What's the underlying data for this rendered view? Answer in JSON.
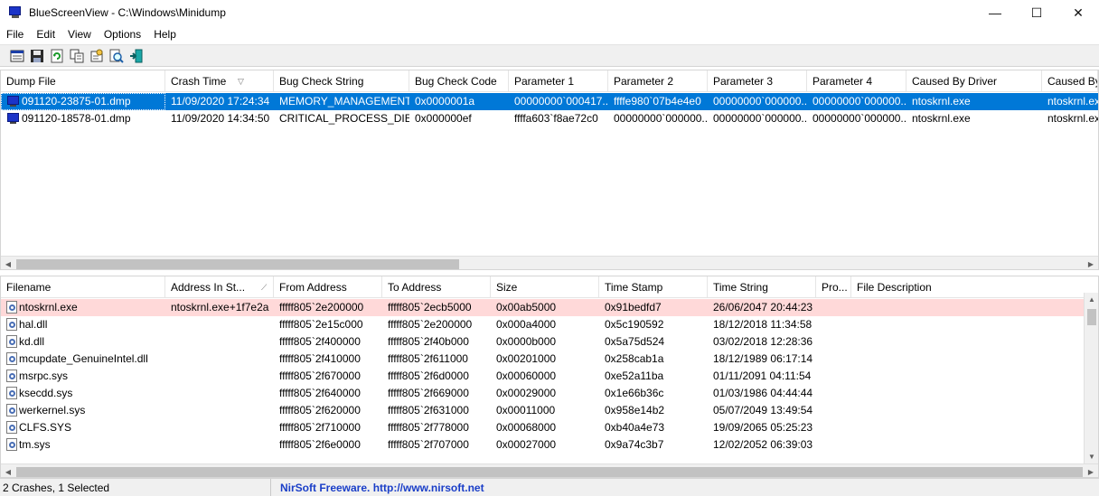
{
  "window": {
    "app_name": "BlueScreenView",
    "separator": " - ",
    "path": "C:\\Windows\\Minidump",
    "min": "—",
    "max": "☐",
    "close": "✕"
  },
  "menu": [
    "File",
    "Edit",
    "View",
    "Options",
    "Help"
  ],
  "upper": {
    "columns": [
      "Dump File",
      "Crash Time",
      "Bug Check String",
      "Bug Check Code",
      "Parameter 1",
      "Parameter 2",
      "Parameter 3",
      "Parameter 4",
      "Caused By Driver",
      "Caused By"
    ],
    "rows": [
      [
        "091120-23875-01.dmp",
        "11/09/2020 17:24:34",
        "MEMORY_MANAGEMENT",
        "0x0000001a",
        "00000000`000417...",
        "ffffe980`07b4e4e0",
        "00000000`000000...",
        "00000000`000000...",
        "ntoskrnl.exe",
        "ntoskrnl.exe"
      ],
      [
        "091120-18578-01.dmp",
        "11/09/2020 14:34:50",
        "CRITICAL_PROCESS_DIED",
        "0x000000ef",
        "ffffa603`f8ae72c0",
        "00000000`000000...",
        "00000000`000000...",
        "00000000`000000...",
        "ntoskrnl.exe",
        "ntoskrnl.exe"
      ]
    ]
  },
  "lower": {
    "columns": [
      "Filename",
      "Address In St...",
      "From Address",
      "To Address",
      "Size",
      "Time Stamp",
      "Time String",
      "Pro...",
      "File Description"
    ],
    "rows": [
      [
        "ntoskrnl.exe",
        "ntoskrnl.exe+1f7e2a",
        "fffff805`2e200000",
        "fffff805`2ecb5000",
        "0x00ab5000",
        "0x91bedfd7",
        "26/06/2047 20:44:23",
        "",
        ""
      ],
      [
        "hal.dll",
        "",
        "fffff805`2e15c000",
        "fffff805`2e200000",
        "0x000a4000",
        "0x5c190592",
        "18/12/2018 11:34:58",
        "",
        ""
      ],
      [
        "kd.dll",
        "",
        "fffff805`2f400000",
        "fffff805`2f40b000",
        "0x0000b000",
        "0x5a75d524",
        "03/02/2018 12:28:36",
        "",
        ""
      ],
      [
        "mcupdate_GenuineIntel.dll",
        "",
        "fffff805`2f410000",
        "fffff805`2f611000",
        "0x00201000",
        "0x258cab1a",
        "18/12/1989 06:17:14",
        "",
        ""
      ],
      [
        "msrpc.sys",
        "",
        "fffff805`2f670000",
        "fffff805`2f6d0000",
        "0x00060000",
        "0xe52a11ba",
        "01/11/2091 04:11:54",
        "",
        ""
      ],
      [
        "ksecdd.sys",
        "",
        "fffff805`2f640000",
        "fffff805`2f669000",
        "0x00029000",
        "0x1e66b36c",
        "01/03/1986 04:44:44",
        "",
        ""
      ],
      [
        "werkernel.sys",
        "",
        "fffff805`2f620000",
        "fffff805`2f631000",
        "0x00011000",
        "0x958e14b2",
        "05/07/2049 13:49:54",
        "",
        ""
      ],
      [
        "CLFS.SYS",
        "",
        "fffff805`2f710000",
        "fffff805`2f778000",
        "0x00068000",
        "0xb40a4e73",
        "19/09/2065 05:25:23",
        "",
        ""
      ],
      [
        "tm.sys",
        "",
        "fffff805`2f6e0000",
        "fffff805`2f707000",
        "0x00027000",
        "0x9a74c3b7",
        "12/02/2052 06:39:03",
        "",
        ""
      ]
    ]
  },
  "status": {
    "count": "2 Crashes, 1 Selected",
    "link": "NirSoft Freeware.  http://www.nirsoft.net"
  },
  "colors": {
    "selection": "#0078d7",
    "highlight_row": "#ffd9d9",
    "link": "#1a3ec8"
  },
  "icons": {
    "app": "bluescreen-monitor-icon",
    "dump": "bluescreen-monitor-icon",
    "module": "driver-file-icon"
  }
}
